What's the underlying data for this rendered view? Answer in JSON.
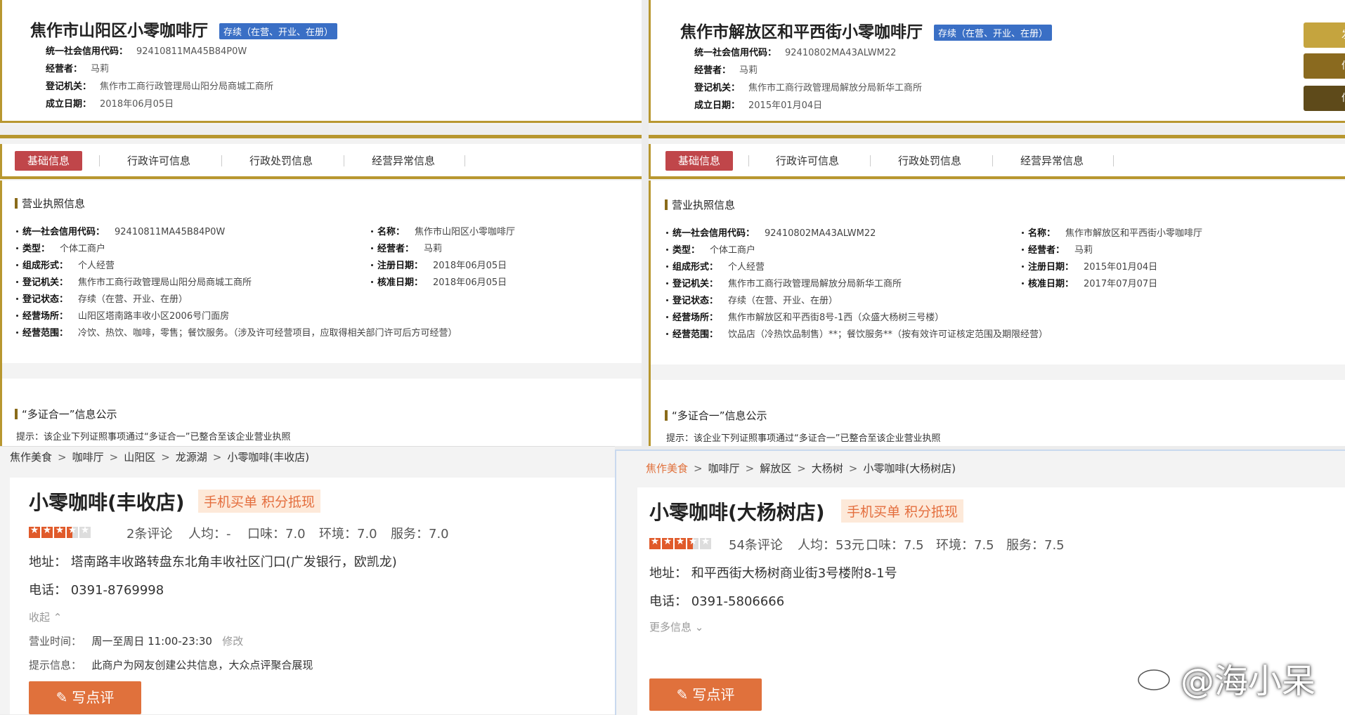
{
  "left_registry": {
    "name": "焦作市山阳区小零咖啡厅",
    "status_badge": "存续（在营、开业、在册）",
    "credit_code_label": "统一社会信用代码：",
    "credit_code": "92410811MA45B84P0W",
    "operator_label": "经营者：",
    "operator": "马莉",
    "authority_label": "登记机关：",
    "authority": "焦作市工商行政管理局山阳分局商城工商所",
    "founded_label": "成立日期：",
    "founded": "2018年06月05日",
    "tabs": [
      "基础信息",
      "行政许可信息",
      "行政处罚信息",
      "经营异常信息"
    ],
    "section_license": "营业执照信息",
    "fields": {
      "credit_code": {
        "label": "统一社会信用代码：",
        "value": "92410811MA45B84P0W"
      },
      "name": {
        "label": "名称：",
        "value": "焦作市山阳区小零咖啡厅"
      },
      "type": {
        "label": "类型：",
        "value": "个体工商户"
      },
      "operator": {
        "label": "经营者：",
        "value": "马莉"
      },
      "form": {
        "label": "组成形式：",
        "value": "个人经营"
      },
      "reg_date": {
        "label": "注册日期：",
        "value": "2018年06月05日"
      },
      "authority": {
        "label": "登记机关：",
        "value": "焦作市工商行政管理局山阳分局商城工商所"
      },
      "approve_date": {
        "label": "核准日期：",
        "value": "2018年06月05日"
      },
      "status": {
        "label": "登记状态：",
        "value": "存续（在营、开业、在册）"
      },
      "place": {
        "label": "经营场所：",
        "value": "山阳区塔南路丰收小区2006号门面房"
      },
      "scope": {
        "label": "经营范围：",
        "value": "冷饮、热饮、咖啡，零售；餐饮服务。（涉及许可经营项目，应取得相关部门许可后方可经营）"
      }
    },
    "section_multi": "“多证合一”信息公示",
    "hint": "提示：该企业下列证照事项通过“多证合一”已整合至该企业营业执照"
  },
  "right_registry": {
    "name": "焦作市解放区和平西街小零咖啡厅",
    "status_badge": "存续（在营、开业、在册）",
    "credit_code_label": "统一社会信用代码：",
    "credit_code": "92410802MA43ALWM22",
    "operator_label": "经营者：",
    "operator": "马莉",
    "authority_label": "登记机关：",
    "authority": "焦作市工商行政管理局解放分局新华工商所",
    "founded_label": "成立日期：",
    "founded": "2015年01月04日",
    "tabs": [
      "基础信息",
      "行政许可信息",
      "行政处罚信息",
      "经营异常信息"
    ],
    "section_license": "营业执照信息",
    "fields": {
      "credit_code": {
        "label": "统一社会信用代码：",
        "value": "92410802MA43ALWM22"
      },
      "name": {
        "label": "名称：",
        "value": "焦作市解放区和平西街小零咖啡厅"
      },
      "type": {
        "label": "类型：",
        "value": "个体工商户"
      },
      "operator": {
        "label": "经营者：",
        "value": "马莉"
      },
      "form": {
        "label": "组成形式：",
        "value": "个人经营"
      },
      "reg_date": {
        "label": "注册日期：",
        "value": "2015年01月04日"
      },
      "authority": {
        "label": "登记机关：",
        "value": "焦作市工商行政管理局解放分局新华工商所"
      },
      "approve_date": {
        "label": "核准日期：",
        "value": "2017年07月07日"
      },
      "status": {
        "label": "登记状态：",
        "value": "存续（在营、开业、在册）"
      },
      "place": {
        "label": "经营场所：",
        "value": "焦作市解放区和平西街8号-1西（众盛大杨树三号楼）"
      },
      "scope": {
        "label": "经营范围：",
        "value": "饮品店（冷热饮品制售）**；餐饮服务**（按有效许可证核定范围及期限经营）"
      }
    },
    "section_multi": "“多证合一”信息公示",
    "hint": "提示：该企业下列证照事项通过“多证合一”已整合至该企业营业执照"
  },
  "edge_buttons": [
    "发",
    "信",
    "信"
  ],
  "colors": {
    "gold": "#b8972f",
    "tab_active": "#c0464a",
    "badge": "#3a6fc5",
    "dp_orange": "#e0713c"
  },
  "left_shop": {
    "breadcrumb": [
      "焦作美食",
      "咖啡厅",
      "山阳区",
      "龙源湖",
      "小零咖啡(丰收店)"
    ],
    "name": "小零咖啡(丰收店)",
    "promo": "手机买单 积分抵现",
    "rating_stars": 3.5,
    "reviews": "2条评论",
    "avg": "人均：-",
    "taste": "口味：7.0",
    "env": "环境：7.0",
    "service": "服务：7.0",
    "address_label": "地址：",
    "address": "塔南路丰收路转盘东北角丰收社区门口(广发银行，欧凯龙)",
    "phone_label": "电话：",
    "phone": "0391-8769998",
    "collapse": "收起",
    "hours_label": "营业时间：",
    "hours": "周一至周日 11:00-23:30",
    "edit": "修改",
    "tip_label": "提示信息：",
    "tip": "此商户为网友创建公共信息，大众点评聚合展现",
    "write_review": "写点评"
  },
  "right_shop": {
    "breadcrumb": [
      "焦作美食",
      "咖啡厅",
      "解放区",
      "大杨树",
      "小零咖啡(大杨树店)"
    ],
    "name": "小零咖啡(大杨树店)",
    "promo": "手机买单 积分抵现",
    "rating_stars": 3.5,
    "reviews": "54条评论",
    "avg": "人均：53元",
    "taste": "口味：7.5",
    "env": "环境：7.5",
    "service": "服务：7.5",
    "address_label": "地址：",
    "address": "和平西街大杨树商业街3号楼附8-1号",
    "phone_label": "电话：",
    "phone": "0391-5806666",
    "more": "更多信息",
    "write_review": "写点评"
  },
  "watermark": "@海小呆"
}
